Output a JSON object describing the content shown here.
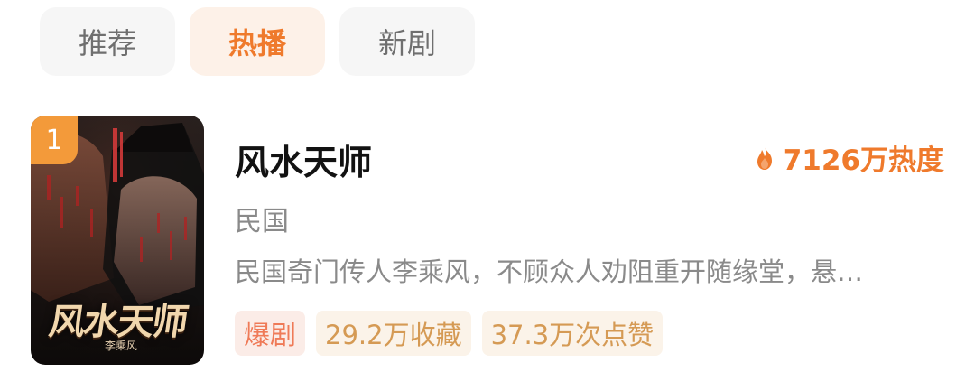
{
  "tabs": [
    {
      "label": "推荐",
      "active": false
    },
    {
      "label": "热播",
      "active": true
    },
    {
      "label": "新剧",
      "active": false
    }
  ],
  "item": {
    "rank": "1",
    "poster_title": "风水天师",
    "poster_signature": "李乘风",
    "title": "风水天师",
    "heat": "7126万热度",
    "genre": "民国",
    "description": "民国奇门传人李乘风，不顾众人劝阻重开随缘堂，悬…",
    "tags": [
      {
        "label": "爆剧"
      },
      {
        "label": "29.2万收藏"
      },
      {
        "label": "37.3万次点赞"
      }
    ]
  },
  "colors": {
    "accent": "#ef7a2c",
    "tab_active_bg": "#fdf1e8",
    "tag_hot_bg": "#fbece7",
    "tag_bg": "#fbf3e9"
  },
  "icons": {
    "heat": "flame-icon"
  }
}
